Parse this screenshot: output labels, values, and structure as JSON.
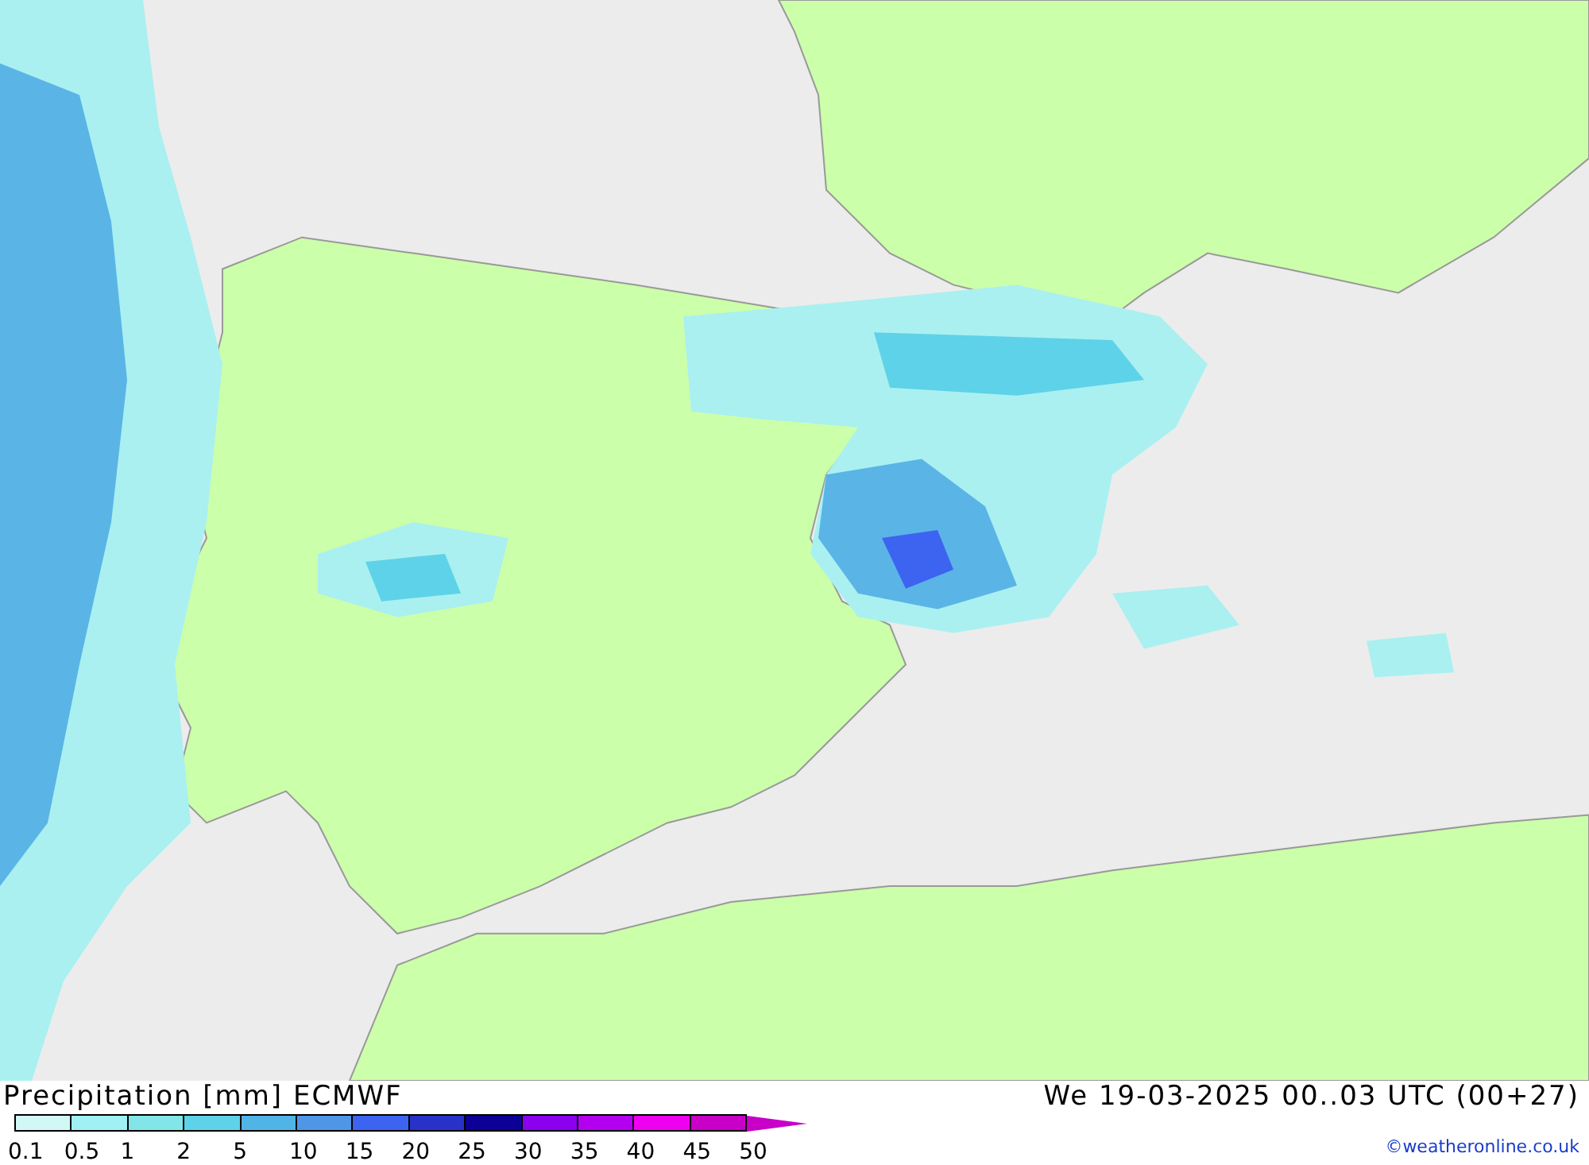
{
  "title": "Precipitation [mm] ECMWF",
  "valid_time": "We 19-03-2025 00..03 UTC (00+27)",
  "legend": {
    "bins": [
      {
        "color": "#d2f8f6"
      },
      {
        "color": "#a0f0f4"
      },
      {
        "color": "#82e6e8"
      },
      {
        "color": "#5ed2e8"
      },
      {
        "color": "#50b4e6"
      },
      {
        "color": "#5096e6"
      },
      {
        "color": "#3c64f0"
      },
      {
        "color": "#2832c8"
      },
      {
        "color": "#0c0096"
      },
      {
        "color": "#8c00f0"
      },
      {
        "color": "#b400f0"
      },
      {
        "color": "#f000f0"
      },
      {
        "color": "#c800c8"
      }
    ],
    "ticks": [
      "0.1",
      "0.5",
      "1",
      "2",
      "5",
      "10",
      "15",
      "20",
      "25",
      "30",
      "35",
      "40",
      "45",
      "50"
    ]
  },
  "credit": "©weatheronline.co.uk"
}
